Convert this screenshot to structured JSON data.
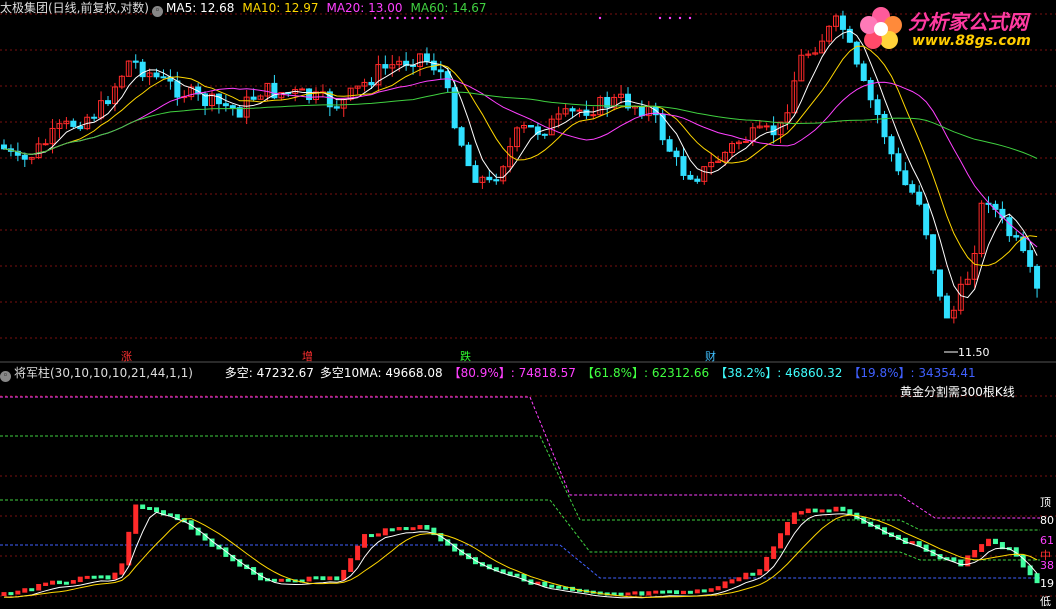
{
  "header": {
    "title": "太极集团(日线,前复权,对数)",
    "ma_labels": [
      {
        "label": "MA5: 12.68",
        "color": "#ffffff"
      },
      {
        "label": "MA10: 12.97",
        "color": "#ffd700"
      },
      {
        "label": "MA20: 13.00",
        "color": "#ff40ff"
      },
      {
        "label": "MA60: 14.67",
        "color": "#40d040"
      }
    ]
  },
  "logo": {
    "title": "分析家公式网",
    "url": "www.88gs.com"
  },
  "markers": [
    {
      "text": "涨",
      "color": "#ff3030"
    },
    {
      "text": "增",
      "color": "#ff3030"
    },
    {
      "text": "跌",
      "color": "#30ff30"
    },
    {
      "text": "财",
      "color": "#40c0ff"
    }
  ],
  "low_label": "11.50",
  "indicator": {
    "name": "将军柱(30,10,10,10,21,44,1,1)",
    "values": [
      {
        "label": "多空: 47232.67",
        "color": "#ffffff"
      },
      {
        "label": "多空10MA: 49668.08",
        "color": "#ffffff"
      },
      {
        "label": "【80.9%】: 74818.57",
        "color": "#ff40ff"
      },
      {
        "label": "【61.8%】: 62312.66",
        "color": "#40ff40"
      },
      {
        "label": "【38.2%】: 46860.32",
        "color": "#40ffff"
      },
      {
        "label": "【19.8%】: 34354.41",
        "color": "#4060ff"
      }
    ],
    "note": "黄金分割需300根K线",
    "right_labels": [
      {
        "text": "顶",
        "color": "#ffffff"
      },
      {
        "text": "80",
        "color": "#ffffff"
      },
      {
        "text": "61",
        "color": "#ff40ff"
      },
      {
        "text": "中",
        "color": "#ff3030"
      },
      {
        "text": "38",
        "color": "#ff40ff"
      },
      {
        "text": "19",
        "color": "#ffffff"
      },
      {
        "text": "低",
        "color": "#ffffff"
      }
    ]
  },
  "chart_data": [
    {
      "type": "candlestick",
      "title": "太极集团(日线,前复权,对数)",
      "x_count": 150,
      "ylim": [
        11.5,
        15.6
      ],
      "grid": true,
      "series": [
        {
          "name": "MA5",
          "value": 12.68
        },
        {
          "name": "MA10",
          "value": 12.97
        },
        {
          "name": "MA20",
          "value": 13.0
        },
        {
          "name": "MA60",
          "value": 14.67
        }
      ],
      "annotations": [
        "11.50"
      ],
      "key_points": {
        "low": 11.5
      }
    },
    {
      "type": "bar",
      "title": "将军柱(30,10,10,10,21,44,1,1)",
      "series": [
        {
          "name": "多空",
          "value": 47232.67
        },
        {
          "name": "多空10MA",
          "value": 49668.08
        },
        {
          "name": "【80.9%】",
          "value": 74818.57
        },
        {
          "name": "【61.8%】",
          "value": 62312.66
        },
        {
          "name": "【38.2%】",
          "value": 46860.32
        },
        {
          "name": "【19.8%】",
          "value": 34354.41
        }
      ]
    }
  ]
}
